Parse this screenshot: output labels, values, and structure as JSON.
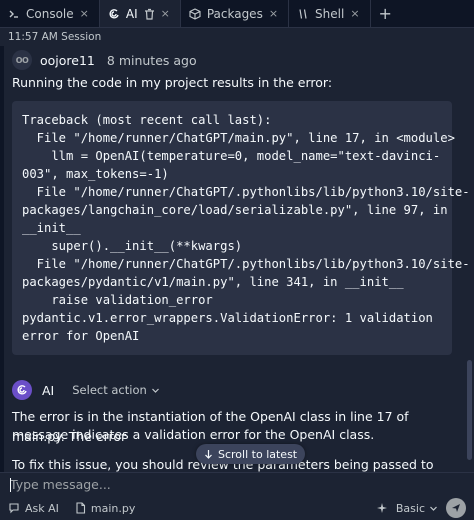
{
  "tabs": [
    {
      "label": "Console",
      "close": "×"
    },
    {
      "label": "AI",
      "close": "×"
    },
    {
      "label": "Packages",
      "close": "×"
    },
    {
      "label": "Shell",
      "close": "×"
    }
  ],
  "tab_add": "+",
  "session_label": "11:57 AM Session",
  "user_message": {
    "avatar_initials": "OO",
    "username": "oojore11",
    "time": "8 minutes ago",
    "text": "Running the code in my project results in the error:",
    "code_lines": [
      "Traceback (most recent call last):",
      "  File \"/home/runner/ChatGPT/main.py\", line 17, in <module>",
      "    llm = OpenAI(temperature=0, model_name=\"text-davinci-",
      "003\", max_tokens=-1)",
      "  File \"/home/runner/ChatGPT/.pythonlibs/lib/python3.10/site-",
      "packages/langchain_core/load/serializable.py\", line 97, in",
      "__init__",
      "    super().__init__(**kwargs)",
      "  File \"/home/runner/ChatGPT/.pythonlibs/lib/python3.10/site-",
      "packages/pydantic/v1/main.py\", line 341, in __init__",
      "    raise validation_error",
      "pydantic.v1.error_wrappers.ValidationError: 1 validation",
      "error for OpenAI"
    ]
  },
  "ai_message": {
    "name": "AI",
    "select_action": "Select action",
    "para1_line1": "The error is in the instantiation of the OpenAI class in line 17 of main.py. The error",
    "para1_line2": "message indicates a validation error for the OpenAI class.",
    "para2_line1": "To fix this issue, you should review the parameters being passed to the OpenAI class"
  },
  "scroll_to_latest": "Scroll to latest",
  "input": {
    "placeholder": "Type message...",
    "value": ""
  },
  "footer": {
    "ask_ai": "Ask AI",
    "file": "main.py",
    "mode": "Basic"
  }
}
